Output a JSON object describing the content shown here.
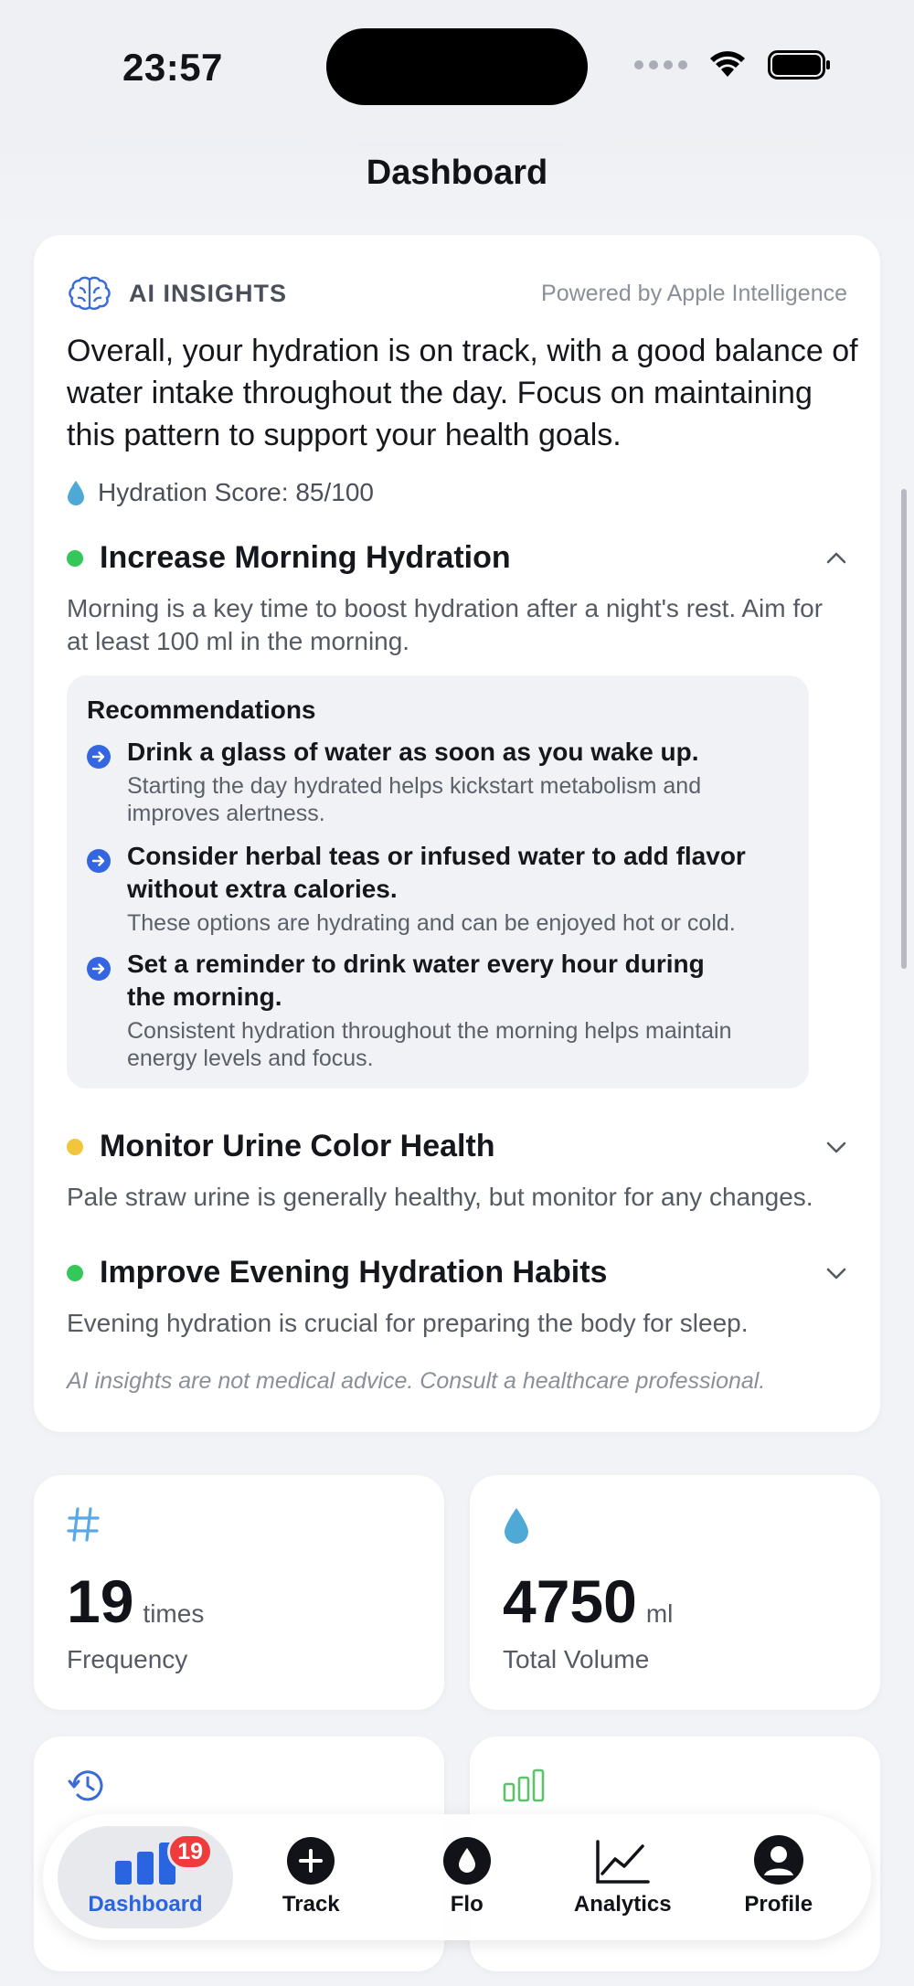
{
  "status_bar": {
    "time": "23:57"
  },
  "page": {
    "title": "Dashboard"
  },
  "ai_insights": {
    "label": "AI INSIGHTS",
    "powered_by": "Powered by Apple Intelligence",
    "summary": "Overall, your hydration is on track, with a good balance of water intake throughout the day. Focus on maintaining this pattern to support your health goals.",
    "score_text": "Hydration Score: 85/100",
    "insights": [
      {
        "title": "Increase Morning Hydration",
        "status_color": "#34c759",
        "expanded": true,
        "description": "Morning is a key time to boost hydration after a night's rest. Aim for at least 100 ml in the morning.",
        "recommendations_header": "Recommendations",
        "recommendations": [
          {
            "title": "Drink a glass of water as soon as you wake up.",
            "detail": "Starting the day hydrated helps kickstart metabolism and improves alertness."
          },
          {
            "title": "Consider herbal teas or infused water to add flavor without extra calories.",
            "detail": "These options are hydrating and can be enjoyed hot or cold."
          },
          {
            "title": "Set a reminder to drink water every hour during the morning.",
            "detail": "Consistent hydration throughout the morning helps maintain energy levels and focus."
          }
        ]
      },
      {
        "title": "Monitor Urine Color Health",
        "status_color": "#f2c53d",
        "expanded": false,
        "description": "Pale straw urine is generally healthy, but monitor for any changes."
      },
      {
        "title": "Improve Evening Hydration Habits",
        "status_color": "#34c759",
        "expanded": false,
        "description": "Evening hydration is crucial for preparing the body for sleep."
      }
    ],
    "disclaimer": "AI insights are not medical advice. Consult a healthcare professional."
  },
  "stats": [
    {
      "icon": "hash-icon",
      "value": "19",
      "unit": "times",
      "caption": "Frequency",
      "color": "#5aa8e6"
    },
    {
      "icon": "drop-icon",
      "value": "4750",
      "unit": "ml",
      "caption": "Total Volume",
      "color": "#4fa9d6"
    }
  ],
  "tabbar": {
    "items": [
      {
        "label": "Dashboard",
        "icon": "bar-chart-icon",
        "badge": "19",
        "active": true
      },
      {
        "label": "Track",
        "icon": "plus-circle-icon"
      },
      {
        "label": "Flo",
        "icon": "drop-circle-icon"
      },
      {
        "label": "Analytics",
        "icon": "line-chart-icon"
      },
      {
        "label": "Profile",
        "icon": "person-circle-icon"
      }
    ]
  },
  "colors": {
    "accent": "#2a64e0",
    "badge": "#ef3b3b"
  }
}
